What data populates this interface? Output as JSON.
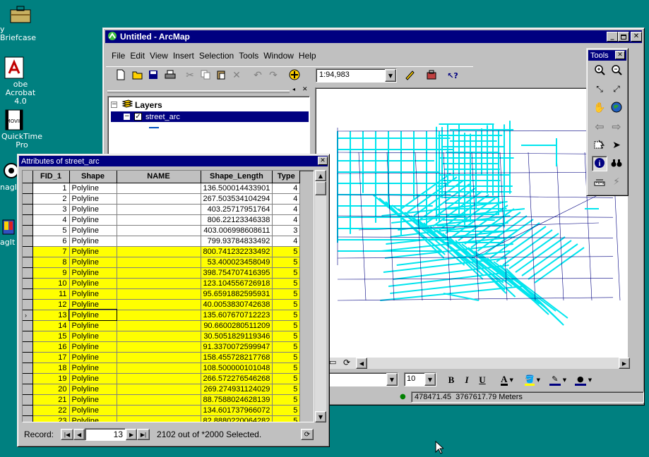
{
  "desktop": {
    "icons": [
      {
        "label_lines": [
          "y Briefcase"
        ]
      },
      {
        "label_lines": [
          "obe Acrobat",
          "4.0"
        ]
      },
      {
        "label_lines": [
          "QuickTime",
          "Pro"
        ]
      },
      {
        "label_lines": [
          "nagI"
        ]
      },
      {
        "label_lines": [
          "agIt"
        ]
      }
    ]
  },
  "arcmap": {
    "title": "Untitled - ArcMap",
    "menu": [
      "File",
      "Edit",
      "View",
      "Insert",
      "Selection",
      "Tools",
      "Window",
      "Help"
    ],
    "scale": "1:94,983",
    "toc": {
      "root": "Layers",
      "layer": "street_arc"
    },
    "font_size": "10",
    "coordinates": "478471.45  3767617.79 Meters",
    "map_color": "#00e5ee"
  },
  "tools_palette": {
    "title": "Tools"
  },
  "attributes": {
    "title": "Attributes of street_arc",
    "columns": [
      "FID_1",
      "Shape",
      "NAME",
      "Shape_Length",
      "Type"
    ],
    "rows": [
      {
        "fid": "1",
        "shape": "Polyline",
        "name": "",
        "length": "136.500014433901",
        "type": "4",
        "hl": false
      },
      {
        "fid": "2",
        "shape": "Polyline",
        "name": "",
        "length": "267.503534104294",
        "type": "4",
        "hl": false
      },
      {
        "fid": "3",
        "shape": "Polyline",
        "name": "",
        "length": "403.25717951764",
        "type": "4",
        "hl": false
      },
      {
        "fid": "4",
        "shape": "Polyline",
        "name": "",
        "length": "806.22123346338",
        "type": "4",
        "hl": false
      },
      {
        "fid": "5",
        "shape": "Polyline",
        "name": "",
        "length": "403.006998608611",
        "type": "3",
        "hl": false
      },
      {
        "fid": "6",
        "shape": "Polyline",
        "name": "",
        "length": "799.93784833492",
        "type": "4",
        "hl": false
      },
      {
        "fid": "7",
        "shape": "Polyline",
        "name": "",
        "length": "800.741232233492",
        "type": "5",
        "hl": true
      },
      {
        "fid": "8",
        "shape": "Polyline",
        "name": "",
        "length": "53.400023458049",
        "type": "5",
        "hl": true
      },
      {
        "fid": "9",
        "shape": "Polyline",
        "name": "",
        "length": "398.754707416395",
        "type": "5",
        "hl": true
      },
      {
        "fid": "10",
        "shape": "Polyline",
        "name": "",
        "length": "123.104556726918",
        "type": "5",
        "hl": true
      },
      {
        "fid": "11",
        "shape": "Polyline",
        "name": "",
        "length": "95.6591882595931",
        "type": "5",
        "hl": true
      },
      {
        "fid": "12",
        "shape": "Polyline",
        "name": "",
        "length": "40.0053830742638",
        "type": "5",
        "hl": true
      },
      {
        "fid": "13",
        "shape": "Polyline",
        "name": "",
        "length": "135.607670712223",
        "type": "5",
        "hl": true,
        "current": true
      },
      {
        "fid": "14",
        "shape": "Polyline",
        "name": "",
        "length": "90.6600280511209",
        "type": "5",
        "hl": true
      },
      {
        "fid": "15",
        "shape": "Polyline",
        "name": "",
        "length": "30.5051829119346",
        "type": "5",
        "hl": true
      },
      {
        "fid": "16",
        "shape": "Polyline",
        "name": "",
        "length": "91.3370072599947",
        "type": "5",
        "hl": true
      },
      {
        "fid": "17",
        "shape": "Polyline",
        "name": "",
        "length": "158.455728217768",
        "type": "5",
        "hl": true
      },
      {
        "fid": "18",
        "shape": "Polyline",
        "name": "",
        "length": "108.500000101048",
        "type": "5",
        "hl": true
      },
      {
        "fid": "19",
        "shape": "Polyline",
        "name": "",
        "length": "266.572276546268",
        "type": "5",
        "hl": true
      },
      {
        "fid": "20",
        "shape": "Polyline",
        "name": "",
        "length": "269.274931124029",
        "type": "5",
        "hl": true
      },
      {
        "fid": "21",
        "shape": "Polyline",
        "name": "",
        "length": "88.7588024628139",
        "type": "5",
        "hl": true
      },
      {
        "fid": "22",
        "shape": "Polyline",
        "name": "",
        "length": "134.601737966072",
        "type": "5",
        "hl": true
      },
      {
        "fid": "23",
        "shape": "Polyline",
        "name": "",
        "length": "82.8880220064282",
        "type": "5",
        "hl": true
      }
    ],
    "record_label": "Record:",
    "record_value": "13",
    "selection_status": "2102 out of *2000 Selected."
  }
}
